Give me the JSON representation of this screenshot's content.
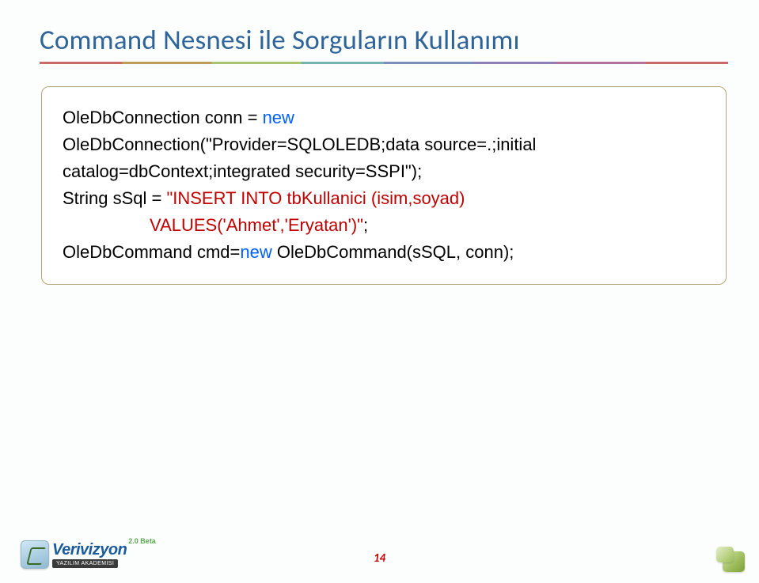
{
  "title": "Command Nesnesi ile Sorguların Kullanımı",
  "code": {
    "l1a": "OleDbConnection conn = ",
    "l1b": "new",
    "l2": "OleDbConnection(\"Provider=SQLOLEDB;data source=.;initial",
    "l3": "catalog=dbContext;integrated security=SSPI\");",
    "l4a": "String sSql = ",
    "l4b": "\"INSERT INTO tbKullanici (isim,soyad)",
    "l5a": "                  VALUES('Ahmet','Eryatan')\"",
    "l5b": ";",
    "l6a": "OleDbCommand cmd=",
    "l6b": "new",
    "l6c": " OleDbCommand(sSQL, conn);"
  },
  "logo": {
    "main": "Verivizyon",
    "tagline": "YAZILIM AKADEMİSİ",
    "beta": "2.0 Beta"
  },
  "pageNumber": "14"
}
